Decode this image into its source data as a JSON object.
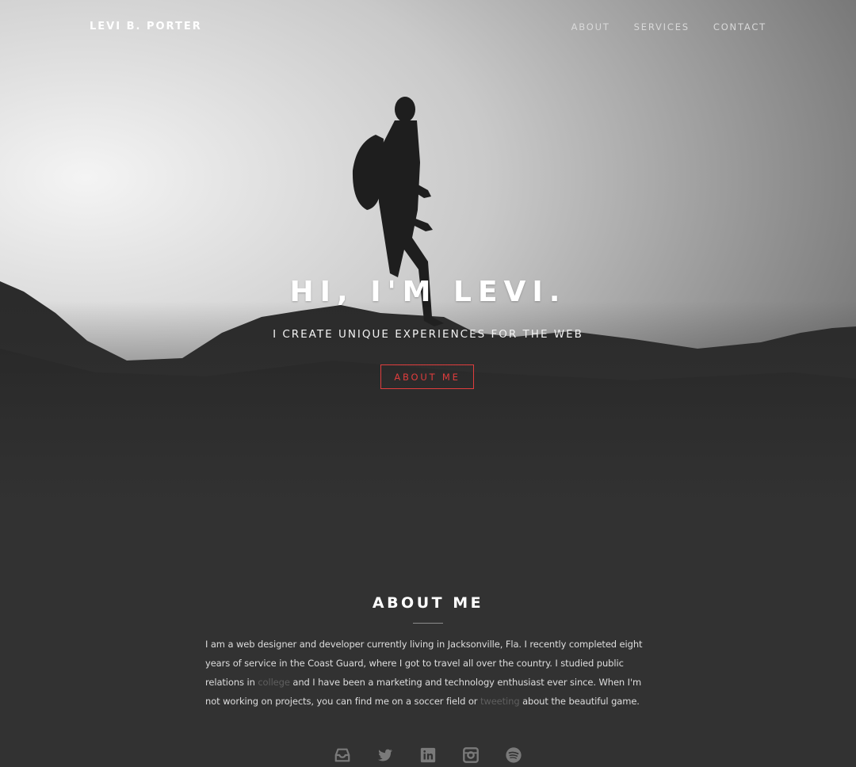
{
  "nav": {
    "brand": "LEVI B. PORTER",
    "links": [
      "ABOUT",
      "SERVICES",
      "CONTACT"
    ]
  },
  "hero": {
    "headline": "HI, I'M LEVI.",
    "subheadline": "I CREATE UNIQUE EXPERIENCES FOR THE WEB",
    "cta_label": "ABOUT ME"
  },
  "about": {
    "title": "ABOUT ME",
    "text_1": "I am a web designer and developer currently living in Jacksonville, Fla. I recently completed eight years of service in the Coast Guard, where I got to travel all over the country. I studied public relations in ",
    "link_college": "college",
    "text_2": " and I have been a marketing and technology enthusiast ever since. When I'm not working on projects, you can find me on a soccer field or ",
    "link_tweeting": "tweeting",
    "text_3": " about the beautiful game."
  },
  "socials": [
    "inbox-icon",
    "twitter-icon",
    "linkedin-icon",
    "instagram-icon",
    "spotify-icon"
  ],
  "colors": {
    "background": "#323232",
    "accent": "#e03d3d",
    "link_muted": "#5f5f5f"
  }
}
